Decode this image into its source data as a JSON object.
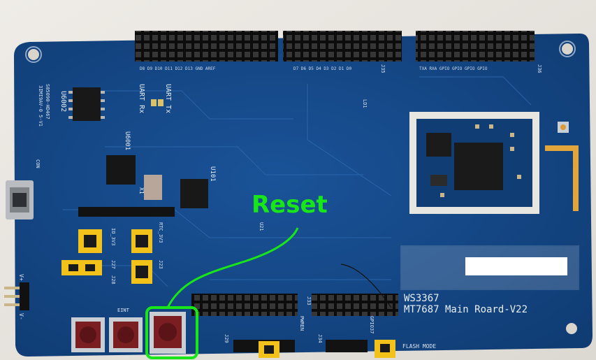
{
  "photo": {
    "board_label_line1": "WS3367",
    "board_label_line2": "MT7687 Main Roard-V22",
    "flash_mode_label": "FLASH MODE",
    "button_label_eint": "EINT",
    "annotation_text": "Reset",
    "annotation_color": "#19e619",
    "board_color": "#154a8a",
    "header_color": "#1b1b1b",
    "jumper_color": "#f2c21a",
    "button_color": "#7a1e22",
    "silk": {
      "u6002": "U6002",
      "u6001": "U6001",
      "u101": "U101",
      "uart_tx": "UART Tx",
      "uart_rx": "UART Rx",
      "x1": "X1",
      "rtc_3v3": "RTC_3V3",
      "j33": "J33",
      "j34": "J34",
      "j29": "J29",
      "j28": "J28",
      "j27": "J27",
      "j23": "J23",
      "j35": "J35",
      "j36": "J36",
      "ld1": "LD1",
      "io_3v3": "IO_3V3",
      "pwren": "PWREN",
      "gpio37": "GPIO37",
      "con": "CON",
      "vplus": "V+",
      "vminus": "V-",
      "u21": "U21",
      "chip_code": "S05090-HD467",
      "chip_code2": "3IMI9AV-0 5-V1"
    }
  }
}
